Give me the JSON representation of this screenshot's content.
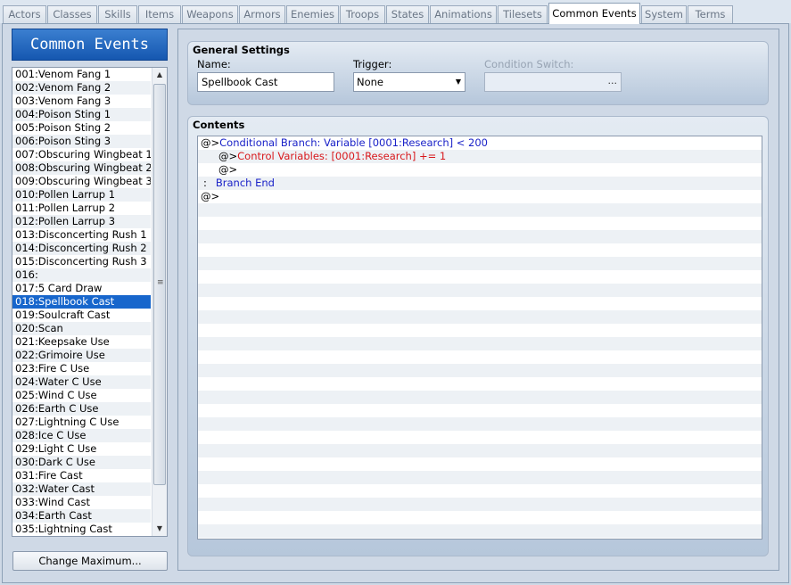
{
  "tabs": [
    {
      "label": "Actors",
      "active": false
    },
    {
      "label": "Classes",
      "active": false
    },
    {
      "label": "Skills",
      "active": false
    },
    {
      "label": "Items",
      "active": false
    },
    {
      "label": "Weapons",
      "active": false
    },
    {
      "label": "Armors",
      "active": false
    },
    {
      "label": "Enemies",
      "active": false
    },
    {
      "label": "Troops",
      "active": false
    },
    {
      "label": "States",
      "active": false
    },
    {
      "label": "Animations",
      "active": false
    },
    {
      "label": "Tilesets",
      "active": false
    },
    {
      "label": "Common Events",
      "active": true
    },
    {
      "label": "System",
      "active": false
    },
    {
      "label": "Terms",
      "active": false
    }
  ],
  "left_panel": {
    "title": "Common Events",
    "selected_index": 17,
    "items": [
      "001:Venom Fang 1",
      "002:Venom Fang 2",
      "003:Venom Fang 3",
      "004:Poison Sting 1",
      "005:Poison Sting 2",
      "006:Poison Sting 3",
      "007:Obscuring Wingbeat 1",
      "008:Obscuring Wingbeat 2",
      "009:Obscuring Wingbeat 3",
      "010:Pollen Larrup 1",
      "011:Pollen Larrup 2",
      "012:Pollen Larrup 3",
      "013:Disconcerting Rush 1",
      "014:Disconcerting Rush 2",
      "015:Disconcerting Rush 3",
      "016:",
      "017:5 Card Draw",
      "018:Spellbook Cast",
      "019:Soulcraft Cast",
      "020:Scan",
      "021:Keepsake Use",
      "022:Grimoire Use",
      "023:Fire C Use",
      "024:Water C Use",
      "025:Wind C Use",
      "026:Earth C Use",
      "027:Lightning C Use",
      "028:Ice C Use",
      "029:Light C Use",
      "030:Dark C Use",
      "031:Fire Cast",
      "032:Water Cast",
      "033:Wind Cast",
      "034:Earth Cast",
      "035:Lightning Cast"
    ],
    "change_maximum_label": "Change Maximum..."
  },
  "general_settings": {
    "title": "General Settings",
    "name_label": "Name:",
    "name_value": "Spellbook Cast",
    "trigger_label": "Trigger:",
    "trigger_value": "None",
    "condition_switch_label": "Condition Switch:",
    "condition_switch_button": "..."
  },
  "contents": {
    "title": "Contents",
    "lines": [
      {
        "prefix": "@>",
        "text": "Conditional Branch: Variable [0001:Research] < 200",
        "color": "blue",
        "indent": 0
      },
      {
        "prefix": "@>",
        "text": "Control Variables: [0001:Research] += 1",
        "color": "red",
        "indent": 1
      },
      {
        "prefix": "@>",
        "text": "",
        "color": "black",
        "indent": 1
      },
      {
        "prefix": ":",
        "text": "Branch End",
        "color": "blue",
        "indent": 0,
        "colon": true
      },
      {
        "prefix": "@>",
        "text": "",
        "color": "black",
        "indent": 0
      }
    ],
    "colors": {
      "blue": "#1a22c8",
      "red": "#d8181c"
    }
  }
}
